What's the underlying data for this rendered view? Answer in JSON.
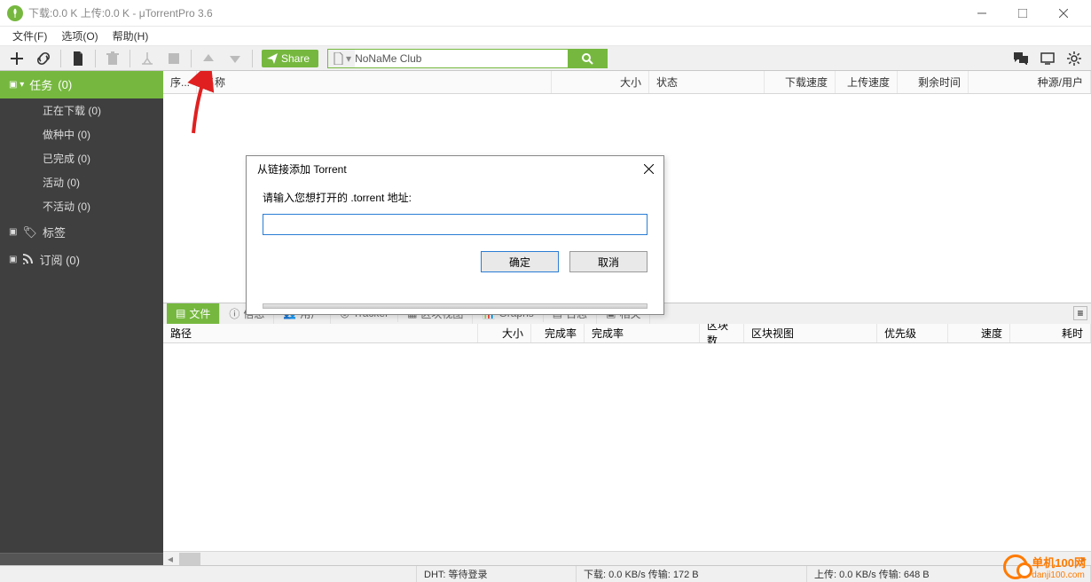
{
  "title": "下载:0.0 K 上传:0.0 K - μTorrentPro 3.6",
  "menu": {
    "file": "文件(F)",
    "options": "选项(O)",
    "help": "帮助(H)"
  },
  "share_label": "Share",
  "search": {
    "value": "NoNaMe Club"
  },
  "sidebar": {
    "tasks": {
      "label": "任务",
      "count": "(0)"
    },
    "items": [
      {
        "label": "正在下载 (0)"
      },
      {
        "label": "做种中 (0)"
      },
      {
        "label": "已完成 (0)"
      },
      {
        "label": "活动 (0)"
      },
      {
        "label": "不活动 (0)"
      }
    ],
    "labels": "标签",
    "feeds": "订阅 (0)"
  },
  "grid_cols": {
    "idx": "序...",
    "name": "名称",
    "size": "大小",
    "status": "状态",
    "dl": "下载速度",
    "ul": "上传速度",
    "eta": "剩余时间",
    "peers": "种源/用户"
  },
  "bottom_tabs": {
    "files": "文件",
    "info": "信息",
    "peers": "用户",
    "tracker": "Tracker",
    "pieces": "区块视图",
    "graphs": "Graphs",
    "log": "日志",
    "related": "相关"
  },
  "detail_cols": {
    "path": "路径",
    "size": "大小",
    "done1": "完成率",
    "done2": "完成率",
    "blocks": "区块数",
    "view": "区块视图",
    "prio": "优先级",
    "speed": "速度",
    "elapsed": "耗时"
  },
  "status": {
    "dht": "DHT: 等待登录",
    "down": "下载: 0.0 KB/s 传输: 172 B",
    "up": "上传: 0.0 KB/s 传输: 648 B"
  },
  "dialog": {
    "title": "从链接添加 Torrent",
    "label": "请输入您想打开的 .torrent 地址:",
    "ok": "确定",
    "cancel": "取消"
  },
  "watermark": {
    "name": "单机100网",
    "url": "danji100.com"
  }
}
